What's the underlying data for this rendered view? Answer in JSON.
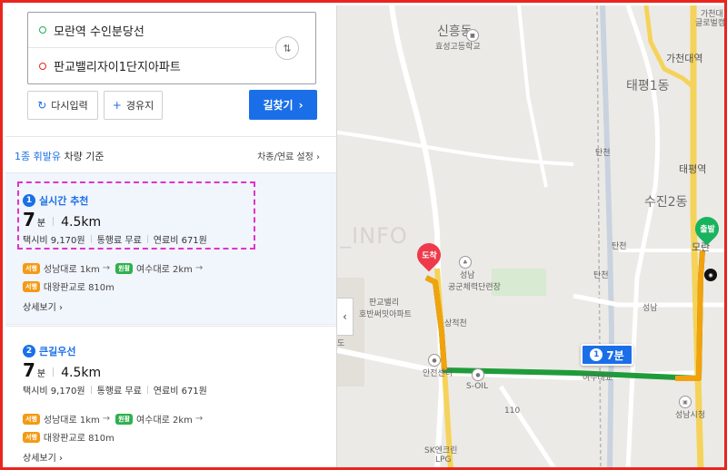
{
  "route": {
    "origin": "모란역 수인분당선",
    "destination": "판교밸리자이1단지아파트",
    "swap_icon": "swap-vertical-icon"
  },
  "actions": {
    "reset_label": "다시입력",
    "waypoint_label": "경유지",
    "search_label": "길찾기",
    "reset_icon": "refresh-icon",
    "waypoint_icon": "plus-icon"
  },
  "vehicle": {
    "type_label": "1종 휘발유",
    "suffix": "차량 기준",
    "settings_label": "차종/연료 설정"
  },
  "results": [
    {
      "rank": "1",
      "name": "실시간 추천",
      "time": "7",
      "time_unit": "분",
      "distance": "4.5km",
      "taxi": "택시비 9,170원",
      "toll": "통행료 무료",
      "fuel": "연료비 671원",
      "path": [
        {
          "tag": "서행",
          "color": "orange",
          "text": "성남대로 1km"
        },
        {
          "tag": "원활",
          "color": "green",
          "text": "여수대로 2km"
        }
      ],
      "path2": {
        "tag": "서행",
        "color": "orange",
        "text": "대왕판교로 810m"
      },
      "detail_label": "상세보기"
    },
    {
      "rank": "2",
      "name": "큰길우선",
      "time": "7",
      "time_unit": "분",
      "distance": "4.5km",
      "taxi": "택시비 9,170원",
      "toll": "통행료 무료",
      "fuel": "연료비 671원",
      "path": [
        {
          "tag": "서행",
          "color": "orange",
          "text": "성남대로 1km"
        },
        {
          "tag": "원활",
          "color": "green",
          "text": "여수대로 2km"
        }
      ],
      "path2": {
        "tag": "서행",
        "color": "orange",
        "text": "대왕판교로 810m"
      },
      "detail_label": "상세보기"
    }
  ],
  "map": {
    "labels": {
      "sinheung": "신흥동",
      "school": "효성고등학교",
      "gacheon_tower": "가천대",
      "gacheon_sub": "글로벌캠",
      "gacheon_station": "가천대역",
      "taepyeong1": "태평1동",
      "tancheon": "탄천",
      "taepyeong_station": "태평역",
      "sujin2": "수진2동",
      "tancheon_ic": "탄천",
      "moran": "모란",
      "seongnam": "성남",
      "park": "공군체력단련장",
      "pangyo_valley": "판교밸리",
      "hoban": "호반써밋아파트",
      "sangjeok": "상적천",
      "seongnam_ic": "성남",
      "anjeon": "안전센터",
      "soil": "S-OIL",
      "yeosu": "여수대교",
      "city_hall": "성남시청",
      "sk_lpg": "SK엔크린",
      "lpg": "LPG",
      "road_110": "110",
      "rd": "도",
      "tancheon2": "탄천"
    },
    "end_label": "도착",
    "start_label": "출발",
    "time_badge": {
      "rank": "1",
      "text": "7분"
    },
    "watermark": "HH_INFO",
    "collapse_icon": "chevron-left-icon"
  }
}
